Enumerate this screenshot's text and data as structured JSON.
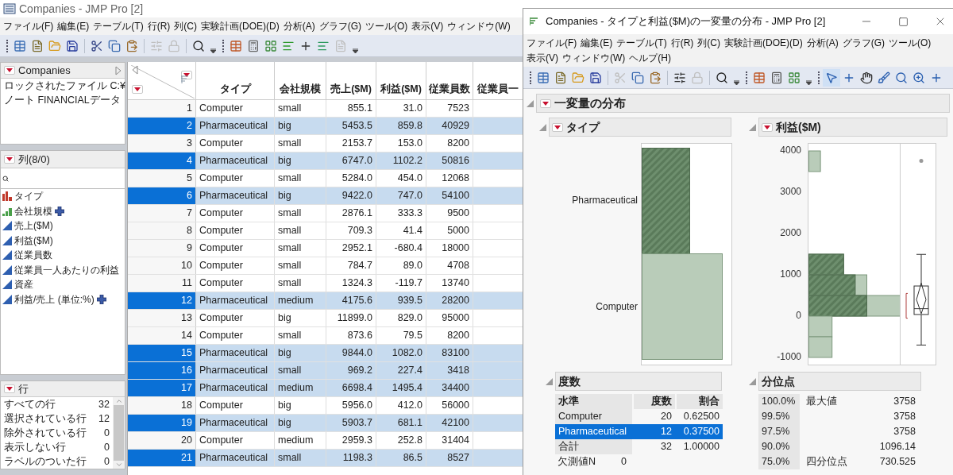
{
  "left_window": {
    "title": "Companies - JMP Pro [2]",
    "menu": [
      "ファイル(F)",
      "編集(E)",
      "テーブル(T)",
      "行(R)",
      "列(C)",
      "実験計画(DOE)(D)",
      "分析(A)",
      "グラフ(G)",
      "ツール(O)",
      "表示(V)",
      "ウィンドウ(W)"
    ],
    "table_panel": {
      "title": "Companies",
      "notes": [
        "ロックされたファイル C:¥",
        "ノート FINANCIALデータ"
      ]
    },
    "columns_panel": {
      "title": "列(8/0)",
      "columns": [
        {
          "name": "タイプ",
          "kind": "nominal",
          "formula": false
        },
        {
          "name": "会社規模",
          "kind": "ordinal",
          "formula": true
        },
        {
          "name": "売上($M)",
          "kind": "continuous",
          "formula": false
        },
        {
          "name": "利益($M)",
          "kind": "continuous",
          "formula": false
        },
        {
          "name": "従業員数",
          "kind": "continuous",
          "formula": false
        },
        {
          "name": "従業員一人あたりの利益",
          "kind": "continuous",
          "formula": false
        },
        {
          "name": "資産",
          "kind": "continuous",
          "formula": false
        },
        {
          "name": "利益/売上 (単位:%)",
          "kind": "continuous",
          "formula": true
        }
      ]
    },
    "rows_panel": {
      "title": "行",
      "stats": [
        {
          "label": "すべての行",
          "count": "32"
        },
        {
          "label": "選択されている行",
          "count": "12"
        },
        {
          "label": "除外されている行",
          "count": "0"
        },
        {
          "label": "表示しない行",
          "count": "0"
        },
        {
          "label": "ラベルのついた行",
          "count": "0"
        }
      ]
    },
    "table": {
      "columns": [
        "タイプ",
        "会社規模",
        "売上($M)",
        "利益($M)",
        "従業員数",
        "従業員一"
      ],
      "rows": [
        {
          "number": "1",
          "cells": [
            "Computer",
            "small",
            "855.1",
            "31.0",
            "7523"
          ],
          "selected": false
        },
        {
          "number": "2",
          "cells": [
            "Pharmaceutical",
            "big",
            "5453.5",
            "859.8",
            "40929"
          ],
          "selected": true
        },
        {
          "number": "3",
          "cells": [
            "Computer",
            "small",
            "2153.7",
            "153.0",
            "8200"
          ],
          "selected": false
        },
        {
          "number": "4",
          "cells": [
            "Pharmaceutical",
            "big",
            "6747.0",
            "1102.2",
            "50816"
          ],
          "selected": true
        },
        {
          "number": "5",
          "cells": [
            "Computer",
            "small",
            "5284.0",
            "454.0",
            "12068"
          ],
          "selected": false
        },
        {
          "number": "6",
          "cells": [
            "Pharmaceutical",
            "big",
            "9422.0",
            "747.0",
            "54100"
          ],
          "selected": true
        },
        {
          "number": "7",
          "cells": [
            "Computer",
            "small",
            "2876.1",
            "333.3",
            "9500"
          ],
          "selected": false
        },
        {
          "number": "8",
          "cells": [
            "Computer",
            "small",
            "709.3",
            "41.4",
            "5000"
          ],
          "selected": false
        },
        {
          "number": "9",
          "cells": [
            "Computer",
            "small",
            "2952.1",
            "-680.4",
            "18000"
          ],
          "selected": false
        },
        {
          "number": "10",
          "cells": [
            "Computer",
            "small",
            "784.7",
            "89.0",
            "4708"
          ],
          "selected": false
        },
        {
          "number": "11",
          "cells": [
            "Computer",
            "small",
            "1324.3",
            "-119.7",
            "13740"
          ],
          "selected": false
        },
        {
          "number": "12",
          "cells": [
            "Pharmaceutical",
            "medium",
            "4175.6",
            "939.5",
            "28200"
          ],
          "selected": true
        },
        {
          "number": "13",
          "cells": [
            "Computer",
            "big",
            "11899.0",
            "829.0",
            "95000"
          ],
          "selected": false
        },
        {
          "number": "14",
          "cells": [
            "Computer",
            "small",
            "873.6",
            "79.5",
            "8200"
          ],
          "selected": false
        },
        {
          "number": "15",
          "cells": [
            "Pharmaceutical",
            "big",
            "9844.0",
            "1082.0",
            "83100"
          ],
          "selected": true
        },
        {
          "number": "16",
          "cells": [
            "Pharmaceutical",
            "small",
            "969.2",
            "227.4",
            "3418"
          ],
          "selected": true
        },
        {
          "number": "17",
          "cells": [
            "Pharmaceutical",
            "medium",
            "6698.4",
            "1495.4",
            "34400"
          ],
          "selected": true
        },
        {
          "number": "18",
          "cells": [
            "Computer",
            "big",
            "5956.0",
            "412.0",
            "56000"
          ],
          "selected": false
        },
        {
          "number": "19",
          "cells": [
            "Pharmaceutical",
            "big",
            "5903.7",
            "681.1",
            "42100"
          ],
          "selected": true
        },
        {
          "number": "20",
          "cells": [
            "Computer",
            "medium",
            "2959.3",
            "252.8",
            "31404"
          ],
          "selected": false
        },
        {
          "number": "21",
          "cells": [
            "Pharmaceutical",
            "small",
            "1198.3",
            "86.5",
            "8527"
          ],
          "selected": true
        }
      ]
    }
  },
  "right_window": {
    "title": "Companies - タイプと利益($M)の一変量の分布 - JMP Pro [2]",
    "menu": [
      "ファイル(F)",
      "編集(E)",
      "テーブル(T)",
      "行(R)",
      "列(C)",
      "実験計画(DOE)(D)",
      "分析(A)",
      "グラフ(G)",
      "ツール(O)",
      "表示(V)",
      "ウィンドウ(W)",
      "ヘルプ(H)"
    ],
    "report_title": "一変量の分布",
    "type_section": {
      "title": "タイプ",
      "levels": [
        "Pharmaceutical",
        "Computer"
      ],
      "frequencies": {
        "title": "度数",
        "columns": [
          "水準",
          "度数",
          "割合"
        ],
        "rows": [
          {
            "cells": [
              "Computer",
              "20",
              "0.62500"
            ],
            "selected": false
          },
          {
            "cells": [
              "Pharmaceutical",
              "12",
              "0.37500"
            ],
            "selected": true
          },
          {
            "cells": [
              "合計",
              "32",
              "1.00000"
            ],
            "selected": false
          }
        ],
        "missing": {
          "label": "欠測値N",
          "value": "0"
        }
      }
    },
    "profit_section": {
      "title": "利益($M)",
      "axis_labels": [
        "4000",
        "3000",
        "2000",
        "1000",
        "0",
        "-1000"
      ],
      "quantiles": {
        "title": "分位点",
        "rows": [
          {
            "percent": "100.0%",
            "label": "最大値",
            "value": "3758"
          },
          {
            "percent": "99.5%",
            "value": "3758"
          },
          {
            "percent": "97.5%",
            "value": "3758"
          },
          {
            "percent": "90.0%",
            "value": "1096.14"
          },
          {
            "percent": "75.0%",
            "label": "四分位点",
            "value": "730.525"
          }
        ]
      }
    }
  }
}
